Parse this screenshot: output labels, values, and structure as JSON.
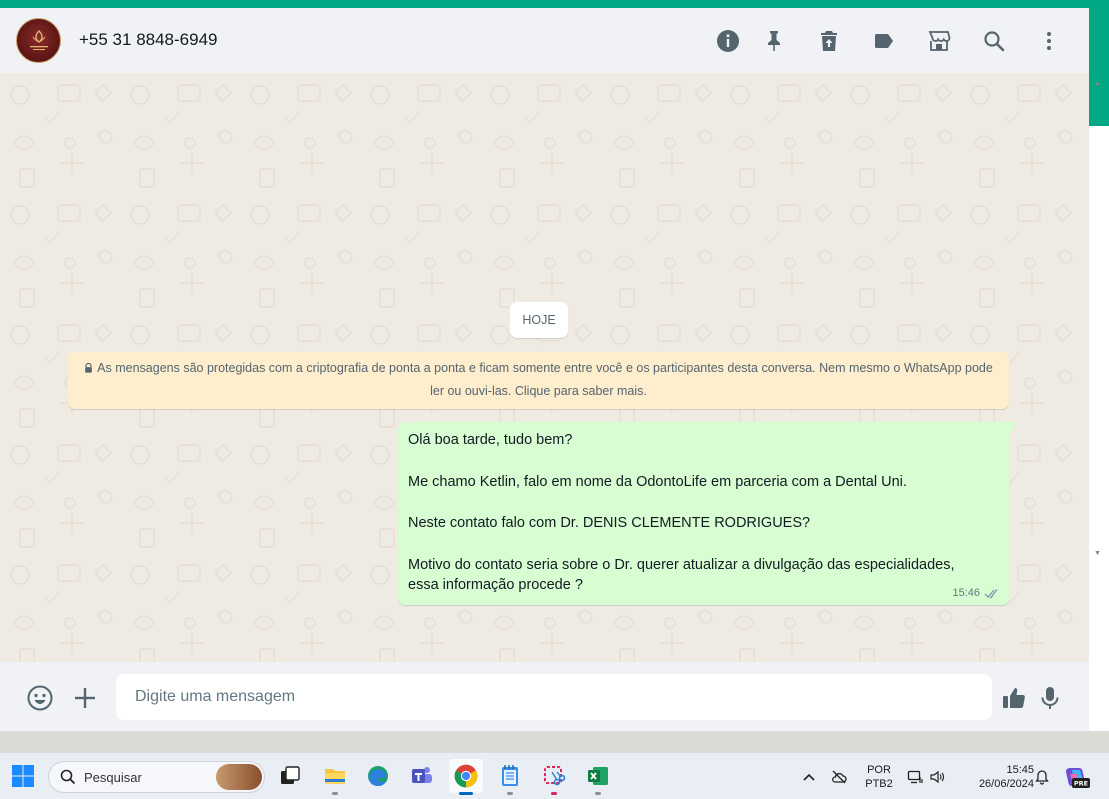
{
  "header": {
    "contact_name": "+55 31 8848-6949",
    "icons": [
      "info-icon",
      "pin-icon",
      "delete-icon",
      "label-icon",
      "store-icon",
      "search-icon",
      "menu-icon"
    ]
  },
  "chat": {
    "date_label": "HOJE",
    "encryption_notice": "As mensagens são protegidas com a criptografia de ponta a ponta e ficam somente entre você e os participantes desta conversa. Nem mesmo o WhatsApp pode ler ou ouvi-las. Clique para saber mais.",
    "messages": [
      {
        "lines": [
          "Olá boa tarde, tudo bem?",
          "",
          "Me chamo Ketlin, falo em nome da OdontoLife em parceria com a Dental Uni.",
          "",
          "Neste contato falo com Dr. DENIS CLEMENTE RODRIGUES?",
          "",
          "Motivo do contato seria sobre o Dr. querer atualizar a divulgação das especialidades,",
          "essa informação procede ?"
        ],
        "time": "15:46",
        "status": "delivered"
      }
    ]
  },
  "composer": {
    "placeholder": "Digite uma mensagem"
  },
  "taskbar": {
    "search_label": "Pesquisar",
    "language_top": "POR",
    "language_bottom": "PTB2",
    "clock_time": "15:45",
    "clock_date": "26/06/2024",
    "copilot_badge": "PRE"
  },
  "colors": {
    "accent": "#00a884",
    "outgoing_bubble": "#d9fdd3",
    "notice_bg": "#ffeecd",
    "chat_bg": "#efeae2"
  }
}
